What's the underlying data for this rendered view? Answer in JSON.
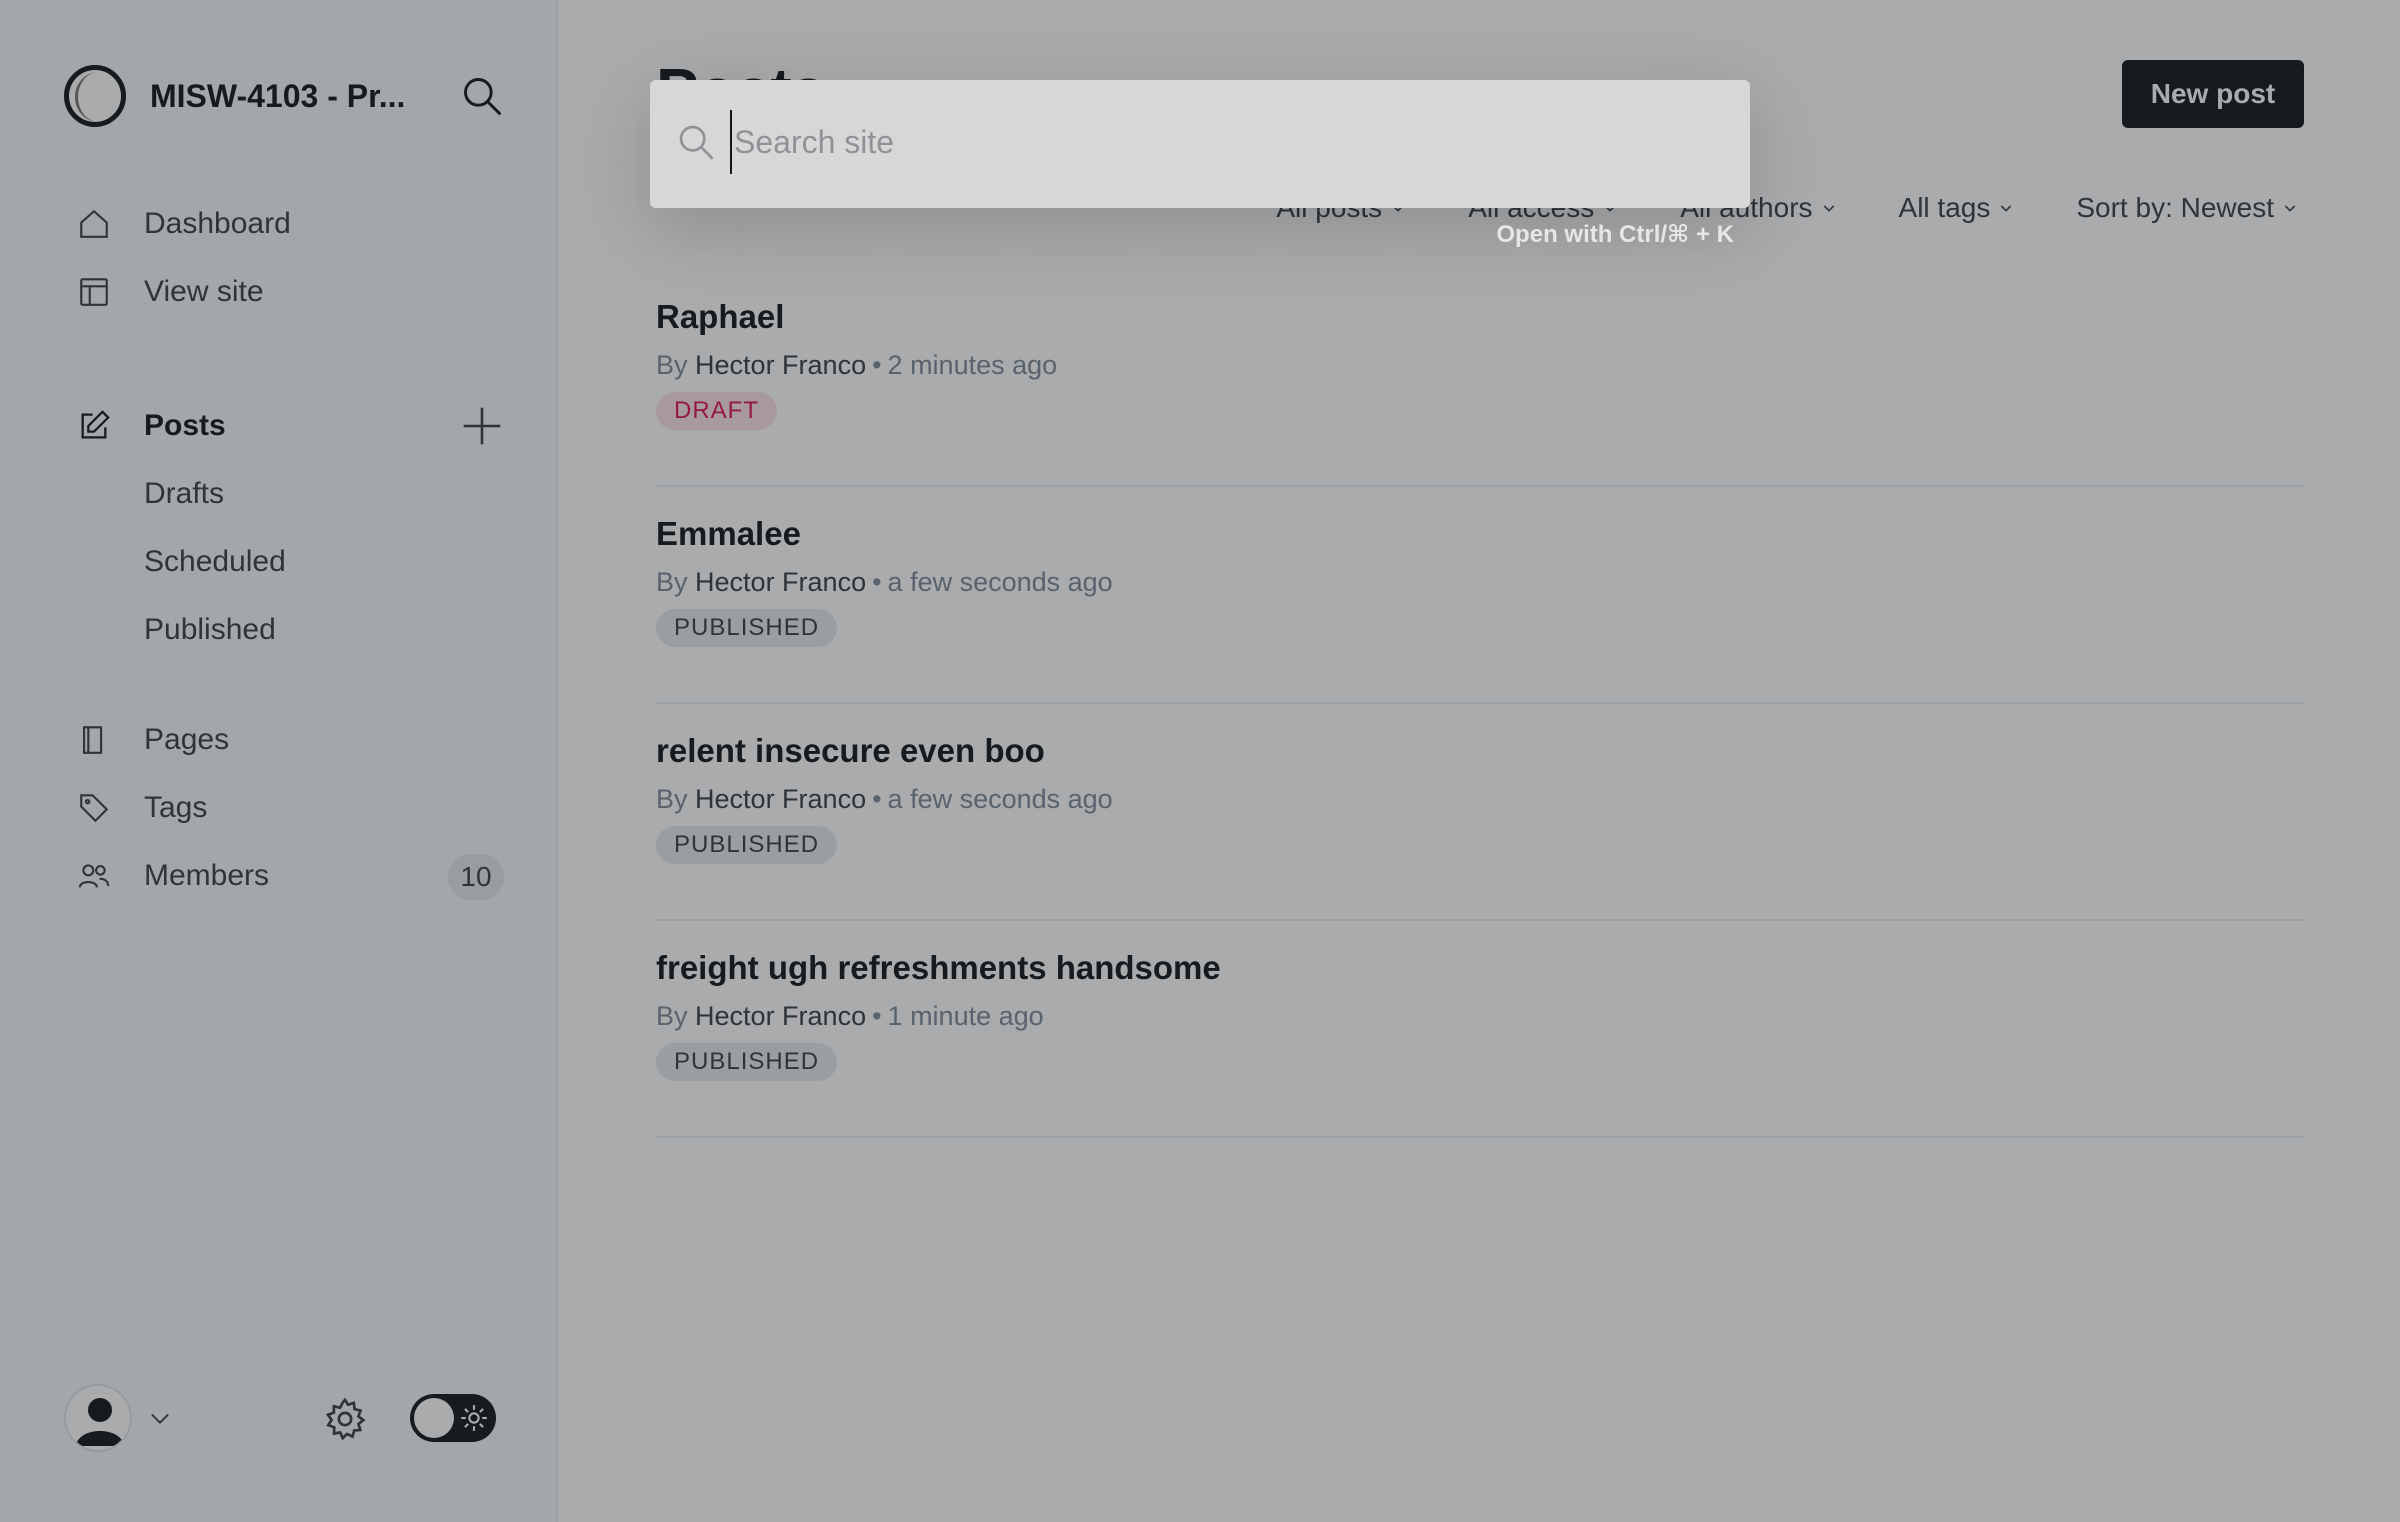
{
  "sidebar": {
    "site_title": "MISW-4103 - Pr...",
    "nav_primary": [
      {
        "label": "Dashboard",
        "icon": "home-icon"
      },
      {
        "label": "View site",
        "icon": "layout-icon"
      }
    ],
    "posts_label": "Posts",
    "posts_sub": [
      "Drafts",
      "Scheduled",
      "Published"
    ],
    "nav_secondary": [
      {
        "label": "Pages",
        "icon": "page-icon"
      },
      {
        "label": "Tags",
        "icon": "tag-icon"
      },
      {
        "label": "Members",
        "icon": "members-icon",
        "count": "10"
      }
    ]
  },
  "main": {
    "title": "Posts",
    "new_post_label": "New post",
    "filters": [
      "All posts",
      "All access",
      "All authors",
      "All tags",
      "Sort by: Newest"
    ],
    "posts": [
      {
        "title": "Raphael",
        "by": "By",
        "author": "Hector Franco",
        "time": "2 minutes ago",
        "status": "DRAFT",
        "status_type": "draft"
      },
      {
        "title": "Emmalee",
        "by": "By",
        "author": "Hector Franco",
        "time": "a few seconds ago",
        "status": "PUBLISHED",
        "status_type": "published"
      },
      {
        "title": "relent insecure even boo",
        "by": "By",
        "author": "Hector Franco",
        "time": "a few seconds ago",
        "status": "PUBLISHED",
        "status_type": "published"
      },
      {
        "title": "freight ugh refreshments handsome",
        "by": "By",
        "author": "Hector Franco",
        "time": "1 minute ago",
        "status": "PUBLISHED",
        "status_type": "published"
      }
    ]
  },
  "search": {
    "placeholder": "Search site",
    "hint": "Open with Ctrl/⌘ + K"
  },
  "colors": {
    "accent_dark": "#15171a",
    "draft": "#e0135c",
    "overlay": "rgba(30,34,38,0.38)"
  }
}
